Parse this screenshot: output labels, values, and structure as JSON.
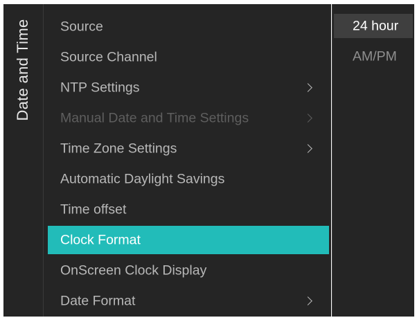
{
  "page_title": "Date and Time",
  "menu": {
    "items": [
      {
        "label": "Source",
        "state": "normal",
        "has_submenu": false
      },
      {
        "label": "Source Channel",
        "state": "normal",
        "has_submenu": false
      },
      {
        "label": "NTP Settings",
        "state": "normal",
        "has_submenu": true
      },
      {
        "label": "Manual Date and Time Settings",
        "state": "disabled",
        "has_submenu": true
      },
      {
        "label": "Time Zone Settings",
        "state": "normal",
        "has_submenu": true
      },
      {
        "label": "Automatic Daylight Savings",
        "state": "normal",
        "has_submenu": false
      },
      {
        "label": "Time offset",
        "state": "normal",
        "has_submenu": false
      },
      {
        "label": "Clock Format",
        "state": "selected",
        "has_submenu": false
      },
      {
        "label": "OnScreen Clock Display",
        "state": "normal",
        "has_submenu": false
      },
      {
        "label": "Date Format",
        "state": "normal",
        "has_submenu": true
      }
    ]
  },
  "submenu": {
    "options": [
      {
        "label": "24 hour",
        "highlighted": true
      },
      {
        "label": "AM/PM",
        "highlighted": false
      }
    ]
  },
  "colors": {
    "panel_background": "#252525",
    "selected_item": "#22bcb9",
    "highlighted_option": "#3f3f3f",
    "item_text": "#b8b8b8",
    "disabled_text": "#5e5e5e"
  },
  "icons": {
    "submenu_indicator": "chevron-right-icon"
  }
}
